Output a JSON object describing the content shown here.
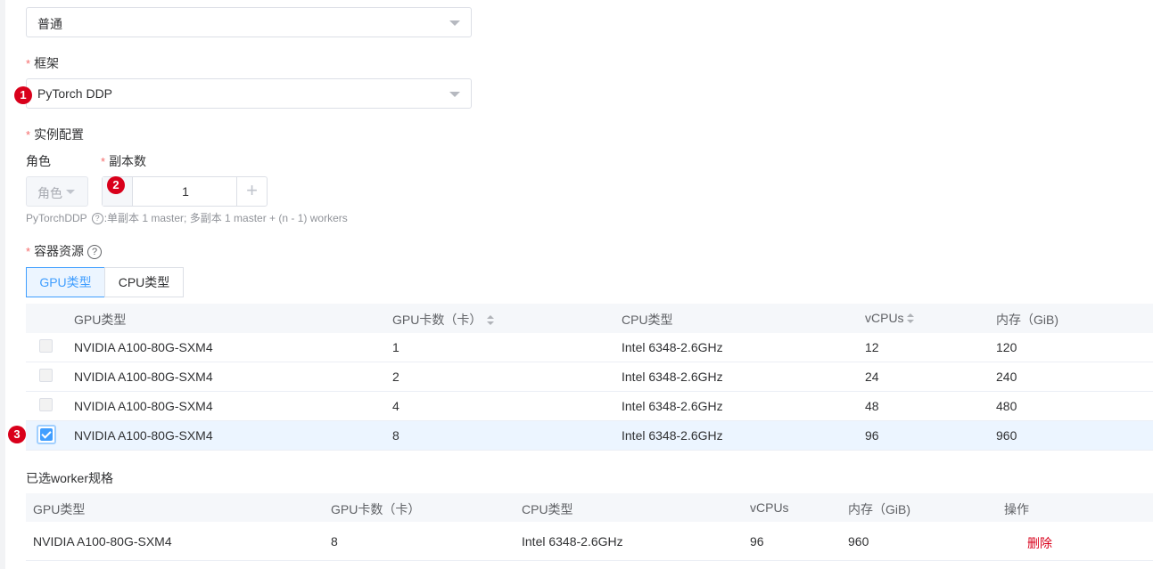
{
  "type_select": {
    "value": "普通"
  },
  "framework": {
    "label": "框架",
    "value": "PyTorch DDP",
    "badge": "1"
  },
  "instance_config": {
    "label": "实例配置"
  },
  "role": {
    "label": "角色",
    "placeholder": "角色"
  },
  "replicas": {
    "label": "副本数",
    "value": "1",
    "badge": "2",
    "plus": "+"
  },
  "hint": {
    "prefix": "PyTorchDDP",
    "q": "?",
    "text": ":单副本 1 master; 多副本 1 master + (n - 1) workers"
  },
  "container": {
    "label": "容器资源",
    "q": "?"
  },
  "tabs": [
    {
      "label": "GPU类型",
      "active": true
    },
    {
      "label": "CPU类型",
      "active": false
    }
  ],
  "gpu_table": {
    "headers": [
      "GPU类型",
      "GPU卡数（卡）",
      "CPU类型",
      "vCPUs",
      "内存（GiB)"
    ],
    "rows": [
      {
        "gpu": "NVIDIA A100-80G-SXM4",
        "cards": "1",
        "cpu": "Intel 6348-2.6GHz",
        "vcpus": "12",
        "mem": "120",
        "checked": false
      },
      {
        "gpu": "NVIDIA A100-80G-SXM4",
        "cards": "2",
        "cpu": "Intel 6348-2.6GHz",
        "vcpus": "24",
        "mem": "240",
        "checked": false
      },
      {
        "gpu": "NVIDIA A100-80G-SXM4",
        "cards": "4",
        "cpu": "Intel 6348-2.6GHz",
        "vcpus": "48",
        "mem": "480",
        "checked": false
      },
      {
        "gpu": "NVIDIA A100-80G-SXM4",
        "cards": "8",
        "cpu": "Intel 6348-2.6GHz",
        "vcpus": "96",
        "mem": "960",
        "checked": true
      }
    ],
    "badge": "3"
  },
  "selected": {
    "title": "已选worker规格",
    "headers": [
      "GPU类型",
      "GPU卡数（卡）",
      "CPU类型",
      "vCPUs",
      "内存（GiB)",
      "操作"
    ],
    "row": {
      "gpu": "NVIDIA A100-80G-SXM4",
      "cards": "8",
      "cpu": "Intel 6348-2.6GHz",
      "vcpus": "96",
      "mem": "960",
      "action": "删除"
    }
  },
  "colors": {
    "accent": "#409eff",
    "danger": "#d9001b",
    "required": "#f56c6c"
  }
}
